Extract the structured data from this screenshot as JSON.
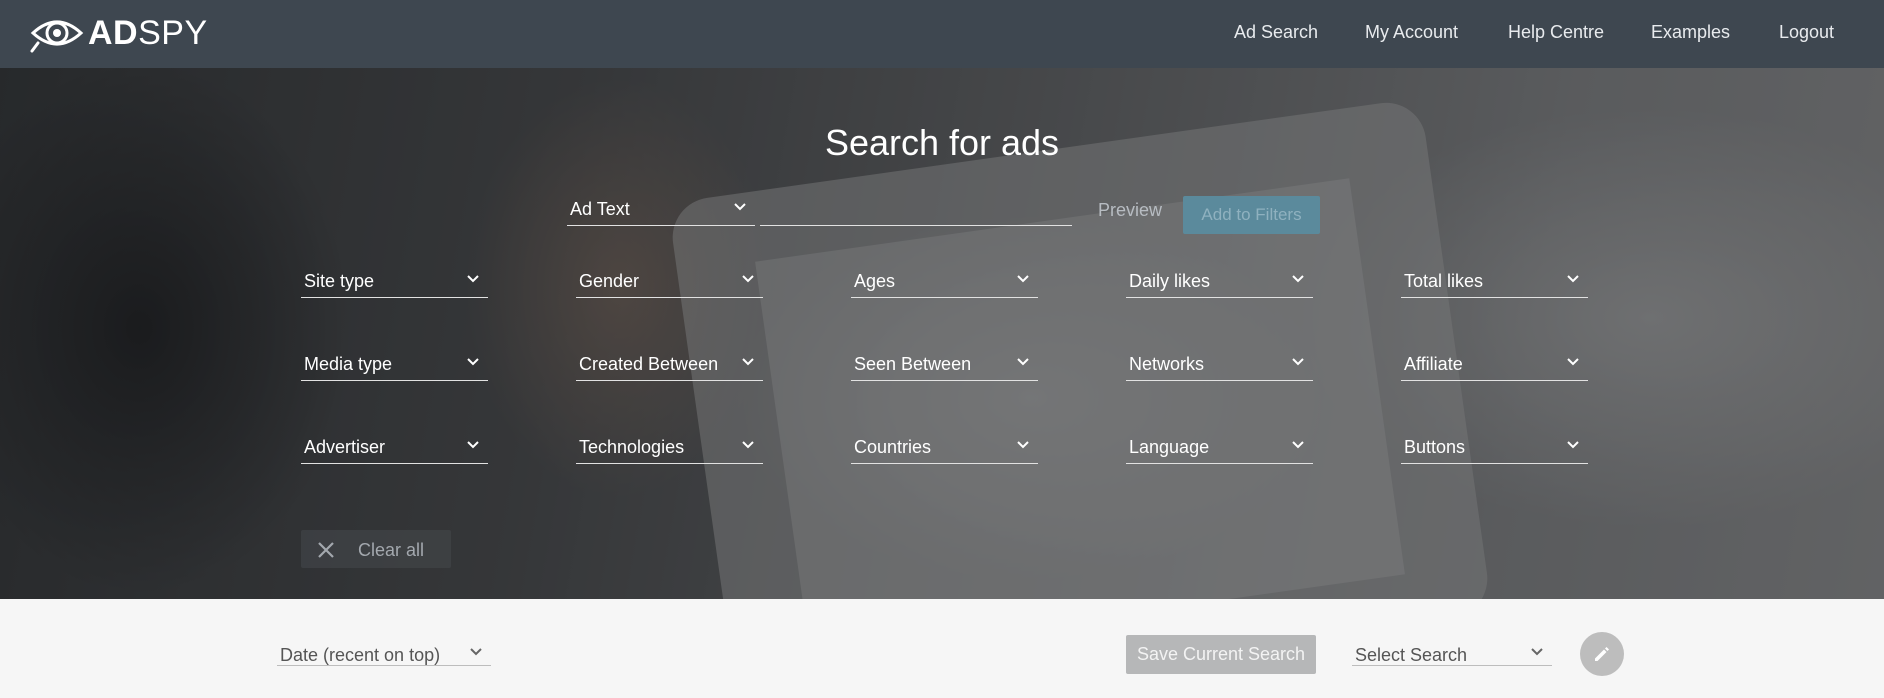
{
  "brand": {
    "name_bold": "AD",
    "name_thin": "SPY",
    "logo_icon": "eye-logo-icon"
  },
  "nav": {
    "items": [
      {
        "label": "Ad Search"
      },
      {
        "label": "My Account"
      },
      {
        "label": "Help Centre"
      },
      {
        "label": "Examples"
      },
      {
        "label": "Logout"
      }
    ]
  },
  "hero": {
    "title": "Search for ads",
    "search": {
      "field_select": "Ad Text",
      "input_value": "",
      "preview_label": "Preview",
      "add_label": "Add to Filters"
    },
    "filters": [
      [
        "Site type",
        "Gender",
        "Ages",
        "Daily likes",
        "Total likes"
      ],
      [
        "Media type",
        "Created Between",
        "Seen Between",
        "Networks",
        "Affiliate"
      ],
      [
        "Advertiser",
        "Technologies",
        "Countries",
        "Language",
        "Buttons"
      ]
    ],
    "clear_label": "Clear all"
  },
  "bottom": {
    "sort": "Date (recent on top)",
    "save_label": "Save Current Search",
    "saved_select": "Select Search",
    "edit_icon": "pencil-icon"
  },
  "colors": {
    "navbar": "#3e4750",
    "add_button": "#5b8a9c",
    "save_button": "#b6b7b8"
  }
}
